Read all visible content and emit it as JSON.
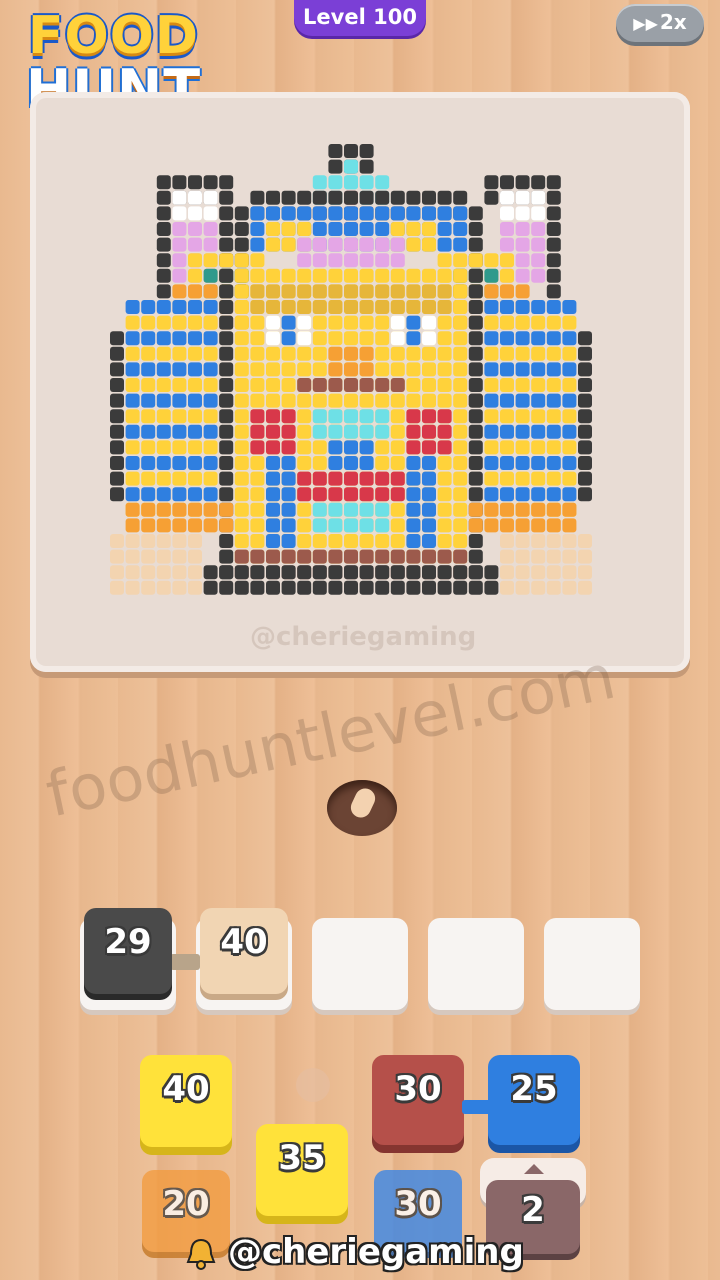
{
  "logo": {
    "line1": "FOOD",
    "line2": "HUNT"
  },
  "level": {
    "label": "Level 100"
  },
  "speed": {
    "icon": "fast-forward-icon",
    "label": "2x"
  },
  "board": {
    "watermark": "@cheriegaming"
  },
  "overlay": {
    "site_watermark": "foodhuntlevel.com"
  },
  "slots": [
    {
      "value": "29",
      "color": "#4a4a4a"
    },
    {
      "value": "40",
      "color": "#f1d5b3"
    },
    {
      "value": "",
      "color": "#f7f4f2"
    },
    {
      "value": "",
      "color": "#f7f4f2"
    },
    {
      "value": "",
      "color": "#f7f4f2"
    }
  ],
  "tray": [
    {
      "value": "40",
      "color": "#ffe23a"
    },
    {
      "value": "30",
      "color": "#b5504a"
    },
    {
      "value": "25",
      "color": "#2f7fe0"
    },
    {
      "value": "35",
      "color": "#ffe23a"
    },
    {
      "value": "20",
      "color": "#f39a3b"
    },
    {
      "value": "30",
      "color": "#3a86e6"
    },
    {
      "value": "2",
      "color": "#8a6768"
    }
  ],
  "footer": {
    "handle": "@cheriegaming"
  },
  "colors": {
    "outline": "#3b3b3b",
    "gold": "#ffd23a",
    "blue": "#2f7fe0",
    "red": "#d8384a",
    "cyan": "#6ee0e6",
    "orange": "#f6a034",
    "lilac": "#e4a6e6",
    "brown": "#9c5a4c",
    "cream": "#f3d4b0"
  }
}
